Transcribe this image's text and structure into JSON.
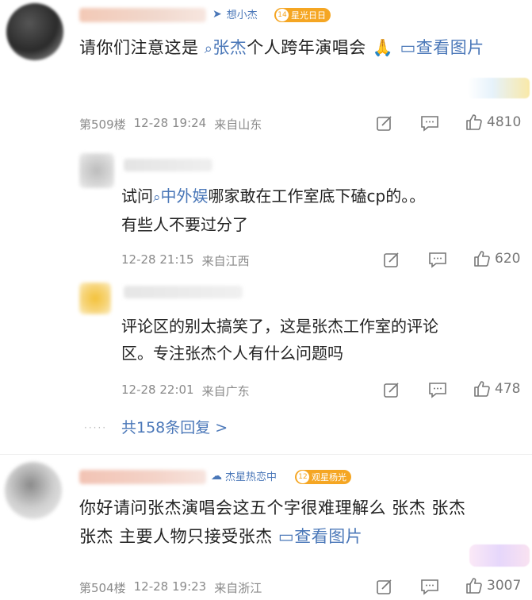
{
  "comments": [
    {
      "tag": "想小杰",
      "badge_level": "14",
      "badge_text": "星光日日",
      "text_prefix": "请你们注意这是 ",
      "topic": "张杰",
      "text_suffix": "个人跨年演唱会",
      "emoji": "🙏",
      "view_image": "查看图片",
      "floor": "第509楼",
      "time": "12-28 19:24",
      "location": "来自山东",
      "likes": "4810"
    },
    {
      "tag": "杰星热恋中",
      "badge_level": "12",
      "badge_text": "观星杨光",
      "text": "你好请问张杰演唱会这五个字很难理解么 张杰 张杰 张杰 主要人物只接受张杰 ",
      "text_line1": "你好请问张杰演唱会这五个字很难理解么 张杰 张杰",
      "text_line2": "张杰 主要人物只接受张杰 ",
      "view_image": "查看图片",
      "floor": "第504楼",
      "time": "12-28 19:23",
      "location": "来自浙江",
      "likes": "3007"
    }
  ],
  "replies": [
    {
      "prefix": "试问",
      "topic": "中外娱",
      "line1_suffix": "哪家敢在工作室底下磕cp的。。",
      "line2": "有些人不要过分了",
      "time": "12-28 21:15",
      "location": "来自江西",
      "likes": "620"
    },
    {
      "line1": "评论区的别太搞笑了，这是张杰工作室的评论",
      "line2": "区。专注张杰个人有什么问题吗",
      "time": "12-28 22:01",
      "location": "来自广东",
      "likes": "478"
    }
  ],
  "more_replies": "共158条回复 >",
  "colors": {
    "link": "#4a77b8",
    "badge_orange": "#f5a623",
    "meta_gray": "#8a8a8a"
  }
}
